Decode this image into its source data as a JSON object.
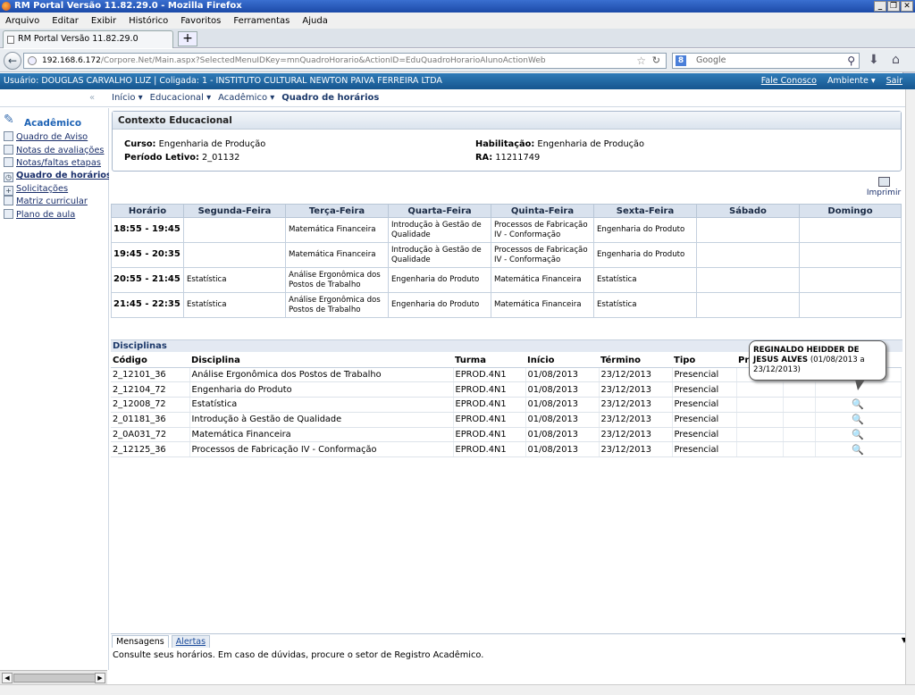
{
  "browser": {
    "title": "RM Portal Versão 11.82.29.0 - Mozilla Firefox",
    "menu": [
      "Arquivo",
      "Editar",
      "Exibir",
      "Histórico",
      "Favoritos",
      "Ferramentas",
      "Ajuda"
    ],
    "tab_title": "RM Portal Versão 11.82.29.0",
    "url_host": "192.168.6.172",
    "url_path": "/Corpore.Net/Main.aspx?SelectedMenuIDKey=mnQuadroHorario&ActionID=EduQuadroHorarioAlunoActionWeb",
    "search_placeholder": "Google"
  },
  "userbar": {
    "text": "Usuário: DOUGLAS CARVALHO LUZ  |  Coligada: 1 - INSTITUTO CULTURAL NEWTON PAIVA FERREIRA LTDA",
    "links": {
      "contact": "Fale Conosco",
      "env": "Ambiente ▾",
      "exit": "Sair"
    }
  },
  "breadcrumb": [
    "Início ▾",
    "Educacional ▾",
    "Acadêmico ▾",
    "Quadro de horários"
  ],
  "sidebar": {
    "title": "Acadêmico",
    "items": [
      {
        "label": "Quadro de Aviso"
      },
      {
        "label": "Notas de avaliações"
      },
      {
        "label": "Notas/faltas etapas"
      },
      {
        "label": "Quadro de horários"
      },
      {
        "label": "Solicitações"
      },
      {
        "label": "Matriz curricular"
      },
      {
        "label": "Plano de aula"
      }
    ]
  },
  "context": {
    "title": "Contexto Educacional",
    "curso_label": "Curso:",
    "curso": "Engenharia de Produção",
    "periodo_label": "Período Letivo:",
    "periodo": "2_01132",
    "habilitacao_label": "Habilitação:",
    "habilitacao": "Engenharia de Produção",
    "ra_label": "RA:",
    "ra": "11211749"
  },
  "print_label": "Imprimir",
  "schedule": {
    "headers": [
      "Horário",
      "Segunda-Feira",
      "Terça-Feira",
      "Quarta-Feira",
      "Quinta-Feira",
      "Sexta-Feira",
      "Sábado",
      "Domingo"
    ],
    "rows": [
      [
        "18:55 - 19:45",
        "",
        "Matemática Financeira",
        "Introdução à Gestão de Qualidade",
        "Processos de Fabricação IV - Conformação",
        "Engenharia do Produto",
        "",
        ""
      ],
      [
        "19:45 - 20:35",
        "",
        "Matemática Financeira",
        "Introdução à Gestão de Qualidade",
        "Processos de Fabricação IV - Conformação",
        "Engenharia do Produto",
        "",
        ""
      ],
      [
        "20:55 - 21:45",
        "Estatística",
        "Análise Ergonômica dos Postos de Trabalho",
        "Engenharia do Produto",
        "Matemática Financeira",
        "Estatística",
        "",
        ""
      ],
      [
        "21:45 - 22:35",
        "Estatística",
        "Análise Ergonômica dos Postos de Trabalho",
        "Engenharia do Produto",
        "Matemática Financeira",
        "Estatística",
        "",
        ""
      ]
    ]
  },
  "disciplinas": {
    "title": "Disciplinas",
    "headers": [
      "Código",
      "Disciplina",
      "Turma",
      "Início",
      "Término",
      "Tipo",
      "Pr",
      "",
      ""
    ],
    "rows": [
      [
        "2_12101_36",
        "Análise Ergonômica dos Postos de Trabalho",
        "EPROD.4N1",
        "01/08/2013",
        "23/12/2013",
        "Presencial"
      ],
      [
        "2_12104_72",
        "Engenharia do Produto",
        "EPROD.4N1",
        "01/08/2013",
        "23/12/2013",
        "Presencial"
      ],
      [
        "2_12008_72",
        "Estatística",
        "EPROD.4N1",
        "01/08/2013",
        "23/12/2013",
        "Presencial"
      ],
      [
        "2_01181_36",
        "Introdução à Gestão de Qualidade",
        "EPROD.4N1",
        "01/08/2013",
        "23/12/2013",
        "Presencial"
      ],
      [
        "2_0A031_72",
        "Matemática Financeira",
        "EPROD.4N1",
        "01/08/2013",
        "23/12/2013",
        "Presencial"
      ],
      [
        "2_12125_36",
        "Processos de Fabricação IV - Conformação",
        "EPROD.4N1",
        "01/08/2013",
        "23/12/2013",
        "Presencial"
      ]
    ]
  },
  "tooltip": {
    "name": "REGINALDO HEIDDER DE JESUS ALVES",
    "dates": "(01/08/2013 a 23/12/2013)"
  },
  "messages": {
    "tabs": [
      "Mensagens",
      "Alertas"
    ],
    "text": "Consulte seus horários. Em caso de dúvidas, procure o setor de Registro Acadêmico."
  }
}
